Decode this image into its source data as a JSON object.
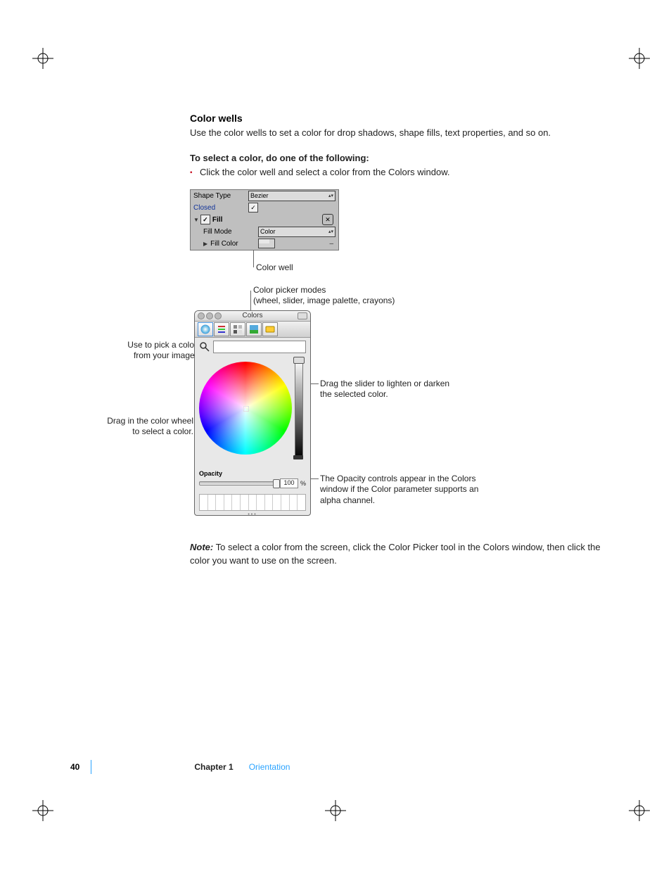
{
  "heading": "Color wells",
  "intro": "Use the color wells to set a color for drop shadows, shape fills, text properties, and so on.",
  "subhead": "To select a color, do one of the following:",
  "bullet1": "Click the color well and select a color from the Colors window.",
  "inspector": {
    "rows": {
      "shapeTypeLabel": "Shape Type",
      "shapeTypeValue": "Bezier",
      "closedLabel": "Closed",
      "fillLabel": "Fill",
      "fillModeLabel": "Fill Mode",
      "fillModeValue": "Color",
      "fillColorLabel": "Fill Color"
    }
  },
  "callouts": {
    "colorWell": "Color well",
    "modes1": "Color picker modes",
    "modes2": "(wheel, slider, image palette, crayons)",
    "mag1": "Use to pick a color",
    "mag2": "from your image.",
    "wheel1": "Drag in the color wheel",
    "wheel2": "to select a color.",
    "slider1": "Drag the slider to lighten or darken",
    "slider2": "the selected color.",
    "op1": "The Opacity controls appear in the Colors",
    "op2": "window if the Color parameter supports an",
    "op3": "alpha channel."
  },
  "colorsWindow": {
    "title": "Colors",
    "opacityLabel": "Opacity",
    "opacityValue": "100",
    "opacityPercent": "%"
  },
  "noteLabel": "Note:",
  "noteBody": "  To select a color from the screen, click the Color Picker tool in the Colors window, then click the color you want to use on the screen.",
  "footer": {
    "page": "40",
    "chapter": "Chapter 1",
    "title": "Orientation"
  }
}
